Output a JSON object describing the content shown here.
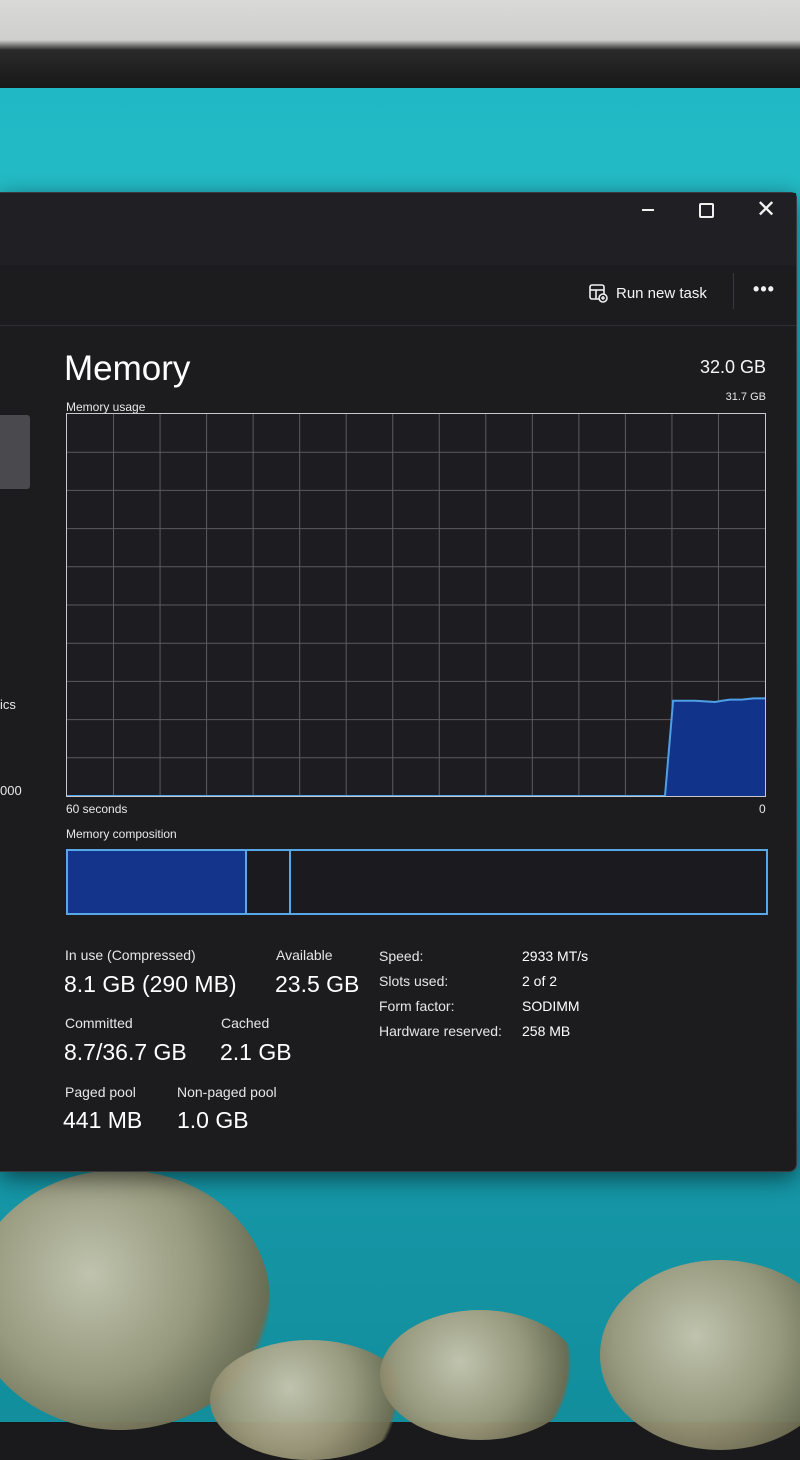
{
  "window": {
    "caption_buttons": {
      "minimize_icon": "minimize-icon",
      "maximize_icon": "maximize-icon",
      "close_icon": "close-icon",
      "close_glyph": "✕"
    }
  },
  "toolbar": {
    "run_new_task_label": "Run new task",
    "run_new_task_icon": "run-task-icon",
    "more_label": "•••"
  },
  "sidebar": {
    "fragment_1": "ics",
    "fragment_2": "000"
  },
  "memory": {
    "title": "Memory",
    "total": "32.0 GB",
    "usage_label": "Memory usage",
    "usage_max": "31.7 GB",
    "axis_left": "60 seconds",
    "axis_right": "0",
    "composition_label": "Memory composition",
    "composition_fractions": {
      "in_use": 0.257,
      "modified": 0.063
    },
    "stats": {
      "in_use_label": "In use (Compressed)",
      "in_use_value": "8.1 GB (290 MB)",
      "available_label": "Available",
      "available_value": "23.5 GB",
      "committed_label": "Committed",
      "committed_value": "8.7/36.7 GB",
      "cached_label": "Cached",
      "cached_value": "2.1 GB",
      "paged_pool_label": "Paged pool",
      "paged_pool_value": "441 MB",
      "non_paged_pool_label": "Non-paged pool",
      "non_paged_pool_value": "1.0 GB"
    },
    "specs": [
      {
        "label": "Speed:",
        "value": "2933 MT/s"
      },
      {
        "label": "Slots used:",
        "value": "2 of 2"
      },
      {
        "label": "Form factor:",
        "value": "SODIMM"
      },
      {
        "label": "Hardware reserved:",
        "value": "258 MB"
      }
    ]
  },
  "chart_data": {
    "type": "area",
    "title": "Memory usage",
    "xlabel": "",
    "ylabel": "",
    "x_range_seconds": [
      60,
      0
    ],
    "ylim": [
      0,
      31.7
    ],
    "grid": true,
    "grid_divisions": {
      "columns": 15,
      "rows": 10
    },
    "series": [
      {
        "color": "#4f9fe6",
        "fill": "#12338a",
        "x": [
          60,
          8.6,
          7.9,
          6.0,
          4.3,
          3.7,
          3.0,
          2.0,
          1.0,
          0
        ],
        "y": [
          0,
          0,
          7.9,
          7.9,
          7.8,
          7.9,
          8.0,
          8.0,
          8.1,
          8.1
        ]
      }
    ],
    "colors": {
      "line": "#4f9fe6",
      "fill": "#12338a",
      "grid": "#5a5a60",
      "border": "#c8c8cc"
    }
  }
}
